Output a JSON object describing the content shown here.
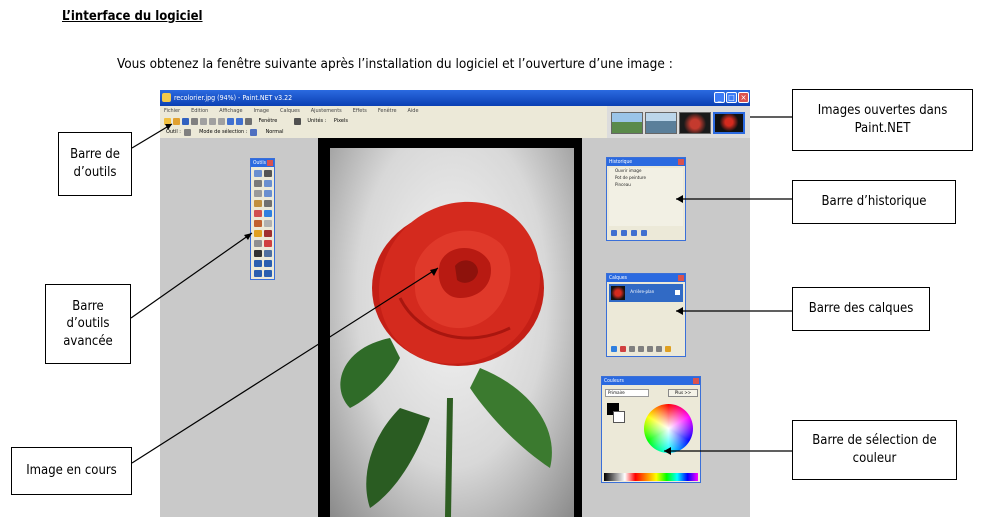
{
  "document": {
    "title": "L’interface du logiciel",
    "intro": "Vous obtenez la fenêtre suivante après l’installation du logiciel et l’ouverture d’une image :"
  },
  "app": {
    "window_title": "recolorier.jpg (94%) - Paint.NET v3.22",
    "menu": [
      "Fichier",
      "Edition",
      "Affichage",
      "Image",
      "Calques",
      "Ajustements",
      "Effets",
      "Fenêtre",
      "Aide"
    ],
    "toolbar_zoom": "Fenêtre",
    "toolbar_units_label": "Unités :",
    "toolbar_units": "Pixels",
    "toolbar2_tool": "Outil :",
    "toolbar2_mode": "Mode de sélection :",
    "toolbar2_normal": "Normal",
    "tools_panel": {
      "title": "Outils"
    },
    "history_panel": {
      "title": "Historique",
      "items": [
        "Ouvrir image",
        "Pot de peinture",
        "Pinceau"
      ]
    },
    "layers_panel": {
      "title": "Calques",
      "layer_name": "Arrière-plan"
    },
    "colors_panel": {
      "title": "Couleurs",
      "primary": "Primaire",
      "more_button": "Plus >>"
    }
  },
  "callouts": {
    "toolbar": "Barre de\nd’outils",
    "advanced_toolbar": "Barre\nd’outils\navancée",
    "current_image": "Image en cours",
    "open_images": "Images ouvertes dans\nPaint.NET",
    "history_bar": "Barre d’historique",
    "layers_bar": "Barre des calques",
    "color_bar": "Barre de sélection de\ncouleur"
  },
  "colors": {
    "titlebar": "#0a3fb3",
    "panel_bg": "#ece9d8",
    "rose": "#d42a1e",
    "leaf": "#3b7a2f"
  }
}
